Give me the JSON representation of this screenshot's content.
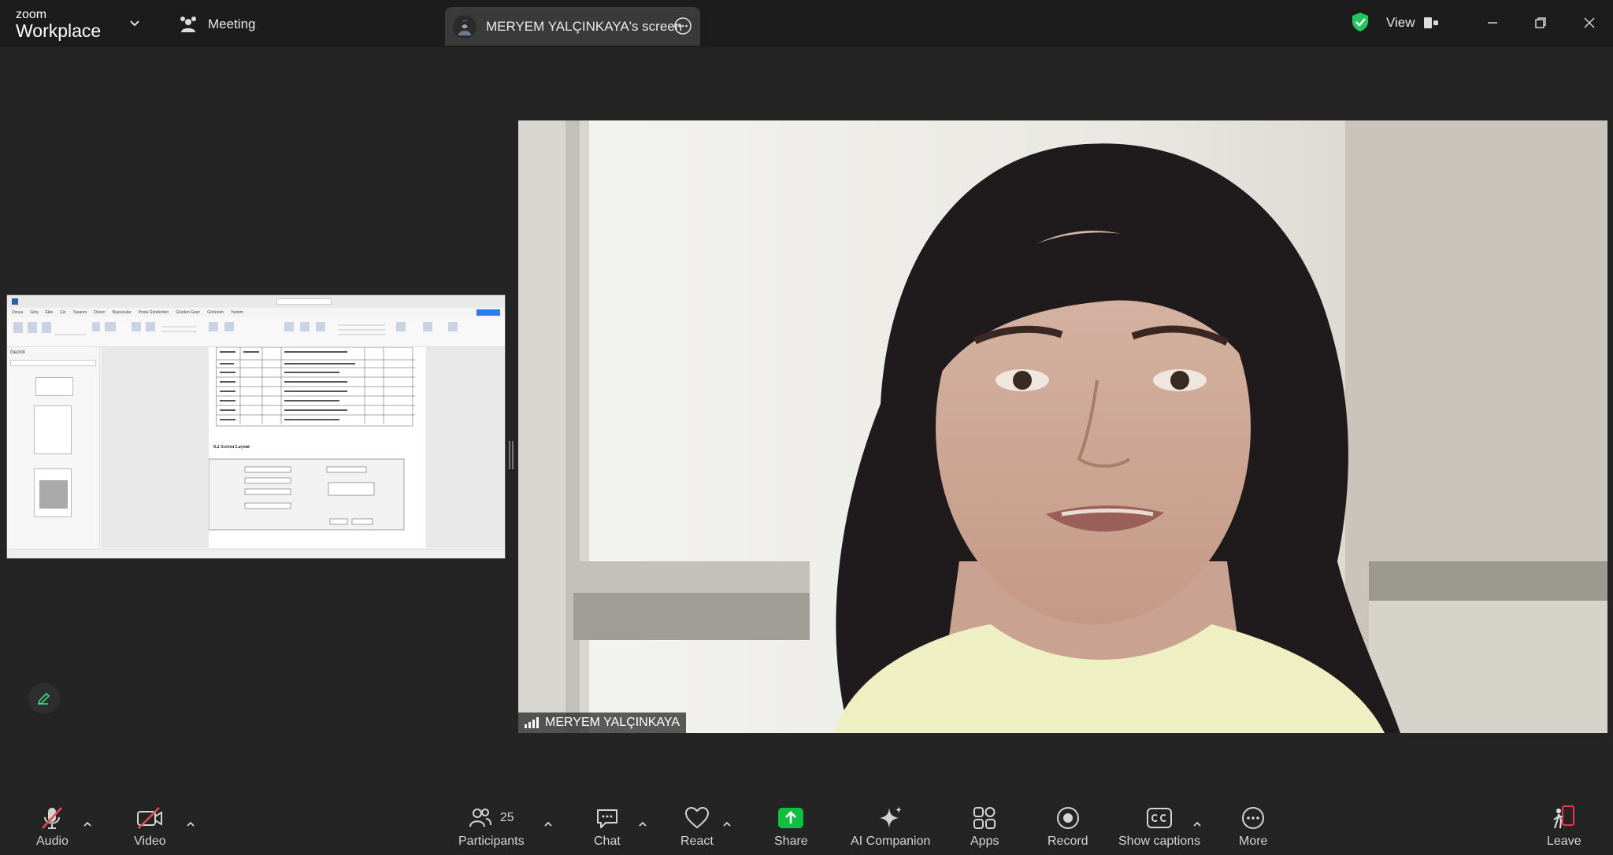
{
  "app": {
    "logo_small": "zoom",
    "logo_big": "Workplace"
  },
  "header": {
    "meeting_label": "Meeting",
    "screen_tab_label": "MERYEM YALÇINKAYA's screen",
    "view_label": "View"
  },
  "video": {
    "participant_name": "MERYEM YALÇINKAYA"
  },
  "shared_doc": {
    "menu": [
      "Dosya",
      "Giriş",
      "Ekle",
      "Çiz",
      "Tasarım",
      "Düzen",
      "Başvurular",
      "Posta Gönderileri",
      "Gözden Geçir",
      "Görünüm",
      "Yardım"
    ],
    "nav_title": "Gezinti",
    "section_heading": "8.2 Screen Layout"
  },
  "toolbar": {
    "audio": "Audio",
    "video": "Video",
    "participants": "Participants",
    "participants_count": "25",
    "chat": "Chat",
    "react": "React",
    "share": "Share",
    "ai_companion": "AI Companion",
    "apps": "Apps",
    "record": "Record",
    "show_captions": "Show captions",
    "more": "More",
    "leave": "Leave"
  },
  "colors": {
    "share_green": "#0fbf3f",
    "leave_red": "#e8384f",
    "mute_red": "#e04a59",
    "shield_green": "#22c55e"
  }
}
